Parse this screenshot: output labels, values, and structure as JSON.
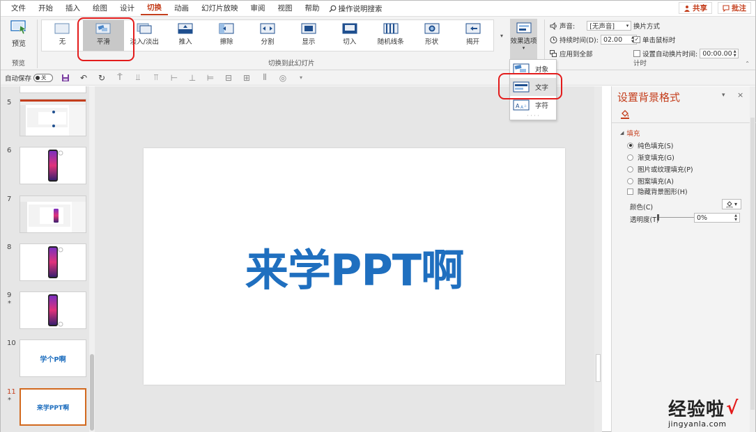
{
  "menu": {
    "items": [
      "文件",
      "开始",
      "插入",
      "绘图",
      "设计",
      "切换",
      "动画",
      "幻灯片放映",
      "审阅",
      "视图",
      "帮助"
    ],
    "active": "切换",
    "search_label": "操作说明搜索",
    "share_label": "共享",
    "comment_label": "批注"
  },
  "ribbon": {
    "preview_label": "预览",
    "preview_group": "预览",
    "transitions": [
      "无",
      "平滑",
      "淡入/淡出",
      "推入",
      "擦除",
      "分割",
      "显示",
      "切入",
      "随机线条",
      "形状",
      "揭开"
    ],
    "selected_transition": "平滑",
    "gallery_group": "切换到此幻灯片",
    "effects_label": "效果选项",
    "timing": {
      "sound_label": "声音:",
      "sound_value": "[无声音]",
      "duration_label": "持续时间(D):",
      "duration_value": "02.00",
      "apply_all_label": "应用到全部",
      "advance_label": "换片方式",
      "on_click_label": "单击鼠标时",
      "on_click_checked": true,
      "after_label": "设置自动换片时间:",
      "after_value": "00:00.00",
      "after_checked": false,
      "group_label": "计时"
    }
  },
  "qat": {
    "autosave_label": "自动保存",
    "autosave_state": "关"
  },
  "effect_options": {
    "items": [
      {
        "label": "对象",
        "icon": "object-effect-icon"
      },
      {
        "label": "文字",
        "icon": "word-effect-icon"
      },
      {
        "label": "字符",
        "icon": "character-effect-icon"
      }
    ],
    "highlighted": "文字"
  },
  "slides": [
    {
      "number": "5",
      "star": false,
      "kind": "screenshot"
    },
    {
      "number": "6",
      "star": false,
      "kind": "phone"
    },
    {
      "number": "7",
      "star": false,
      "kind": "screenshot-phone"
    },
    {
      "number": "8",
      "star": false,
      "kind": "phone"
    },
    {
      "number": "9",
      "star": true,
      "kind": "phone"
    },
    {
      "number": "10",
      "star": false,
      "kind": "text",
      "text": "学个P啊"
    },
    {
      "number": "11",
      "star": true,
      "kind": "text",
      "text": "来学PPT啊",
      "active": true
    }
  ],
  "current_slide": {
    "title": "来学PPT啊"
  },
  "format_pane": {
    "title": "设置背景格式",
    "section": "填充",
    "options": [
      {
        "label": "纯色填充(S)",
        "type": "radio",
        "checked": true
      },
      {
        "label": "渐变填充(G)",
        "type": "radio",
        "checked": false
      },
      {
        "label": "图片或纹理填充(P)",
        "type": "radio",
        "checked": false
      },
      {
        "label": "图案填充(A)",
        "type": "radio",
        "checked": false
      },
      {
        "label": "隐藏背景图形(H)",
        "type": "checkbox",
        "checked": false
      }
    ],
    "color_label": "颜色(C)",
    "transparency_label": "透明度(T)",
    "transparency_value": "0%"
  },
  "watermark": {
    "cn": "经验啦",
    "en": "jingyanla.com"
  },
  "colors": {
    "accent": "#c43e1c",
    "slide_text": "#1f6fbf",
    "highlight": "#e31b1b"
  }
}
